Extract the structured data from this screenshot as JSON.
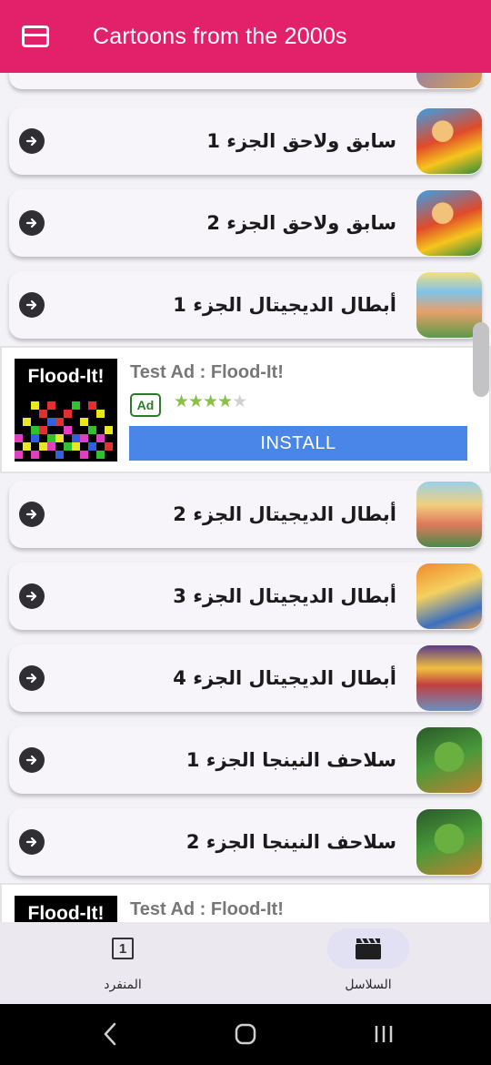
{
  "appbar": {
    "title": "Cartoons from the 2000s"
  },
  "list": {
    "items": [
      {
        "label": "سابق ولاحق الجزء 1"
      },
      {
        "label": "سابق ولاحق الجزء 2"
      },
      {
        "label": "أبطال الديجيتال الجزء 1"
      },
      {
        "label": "أبطال الديجيتال الجزء 2"
      },
      {
        "label": "أبطال الديجيتال الجزء 3"
      },
      {
        "label": "أبطال الديجيتال الجزء 4"
      },
      {
        "label": "سلاحف النينجا الجزء 1"
      },
      {
        "label": "سلاحف النينجا الجزء 2"
      }
    ]
  },
  "ad": {
    "logo_text": "Flood-It!",
    "title": "Test Ad : Flood-It!",
    "badge": "Ad",
    "rating": 4,
    "rating_max": 5,
    "install_label": "INSTALL"
  },
  "bottom_nav": {
    "items": [
      {
        "label": "المنفرد",
        "icon": "numbered-square-icon",
        "glyph": "1",
        "active": false
      },
      {
        "label": "السلاسل",
        "icon": "clapperboard-icon",
        "active": true
      }
    ]
  },
  "colors": {
    "primary": "#e3206a",
    "install": "#4a86e8",
    "ad_badge": "#2d7a2d",
    "active_pill": "#e2e0f3"
  }
}
